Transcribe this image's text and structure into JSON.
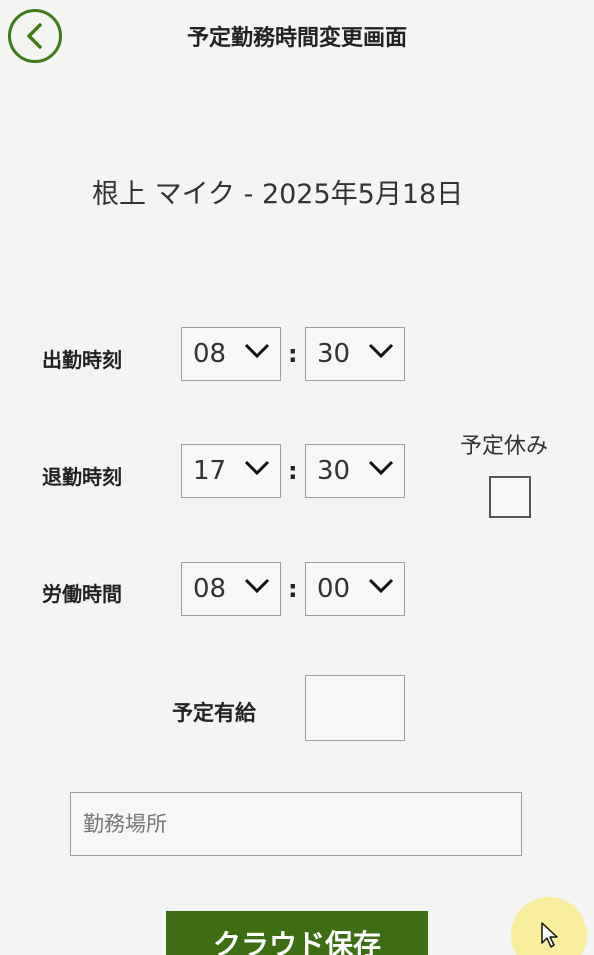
{
  "header": {
    "title": "予定勤務時間変更画面",
    "back_icon": "chevron-left-icon"
  },
  "subtitle": "根上 マイク - 2025年5月18日",
  "rows": [
    {
      "label": "出勤時刻",
      "hour": "08",
      "minute": "30"
    },
    {
      "label": "退勤時刻",
      "hour": "17",
      "minute": "30"
    },
    {
      "label": "労働時間",
      "hour": "08",
      "minute": "00"
    }
  ],
  "separator": ":",
  "scheduled_off": {
    "label": "予定休み",
    "checked": false
  },
  "paid_leave": {
    "label": "予定有給",
    "value": ""
  },
  "location": {
    "placeholder": "勤務場所",
    "value": ""
  },
  "save_button": {
    "label": "クラウド保存"
  },
  "colors": {
    "accent": "#3d6e12",
    "border": "#9e9e9e",
    "background": "#f4f4f2"
  }
}
